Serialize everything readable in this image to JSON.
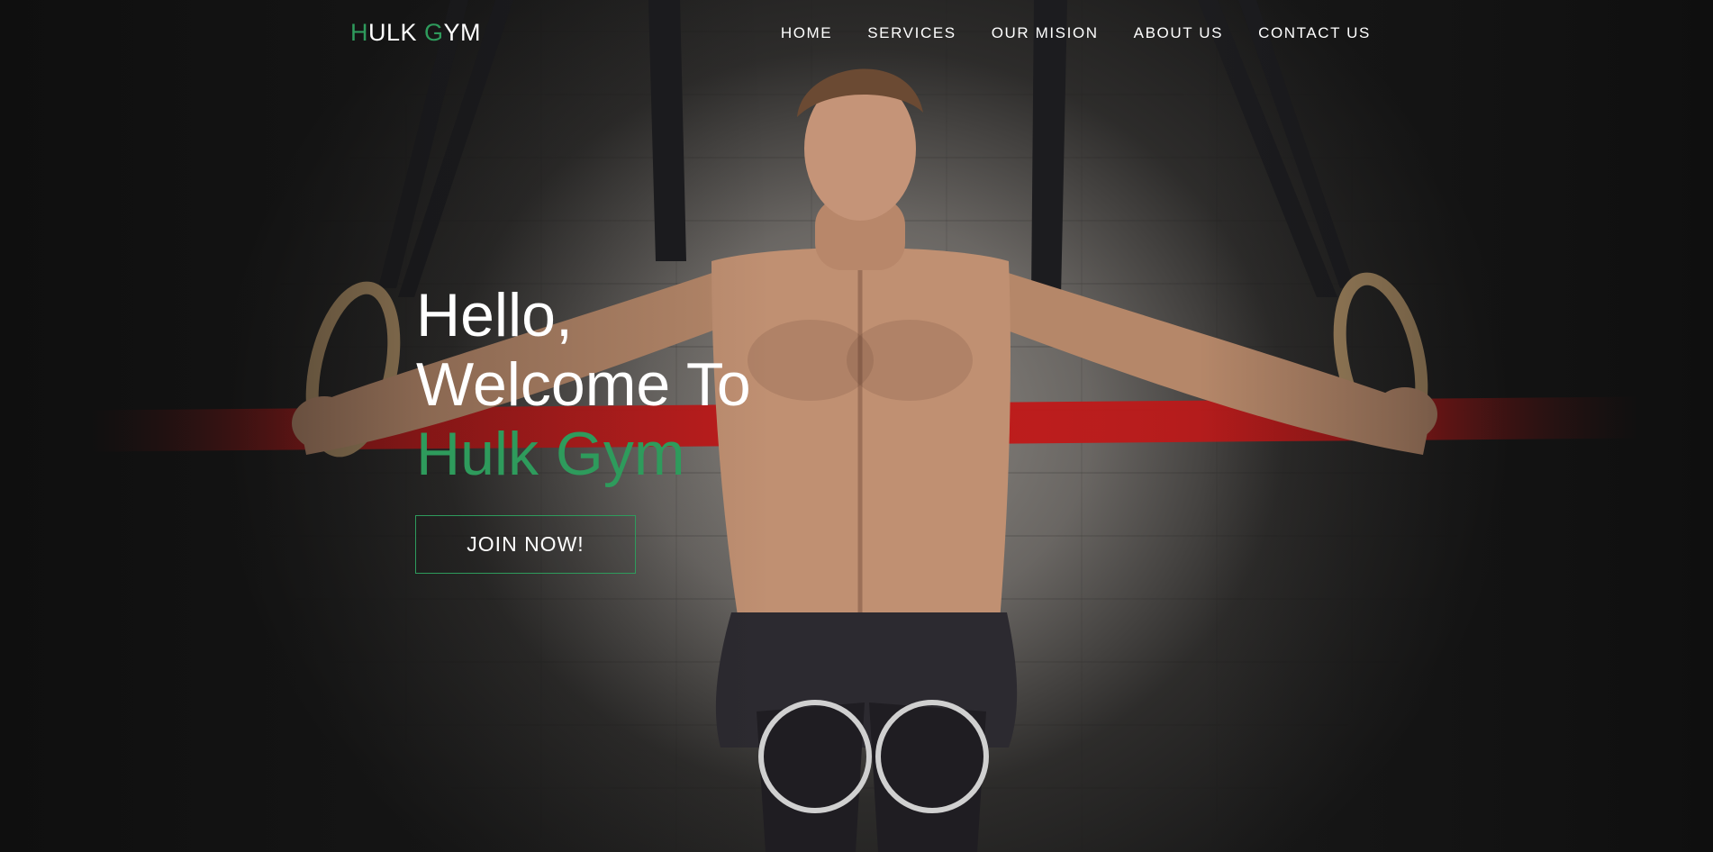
{
  "brand": {
    "first_letter": "H",
    "first_rest": "ULK ",
    "second_letter": "G",
    "second_rest": "YM",
    "accent_color": "#2e9b5c"
  },
  "nav": {
    "items": [
      {
        "label": "HOME"
      },
      {
        "label": "SERVICES"
      },
      {
        "label": "OUR MISION"
      },
      {
        "label": "ABOUT US"
      },
      {
        "label": "CONTACT US"
      }
    ]
  },
  "hero": {
    "line1": "Hello,",
    "line2": "Welcome To",
    "line3": "Hulk Gym",
    "cta_label": "JOIN NOW!",
    "background_image": "athlete-on-gymnastic-rings-photo"
  }
}
